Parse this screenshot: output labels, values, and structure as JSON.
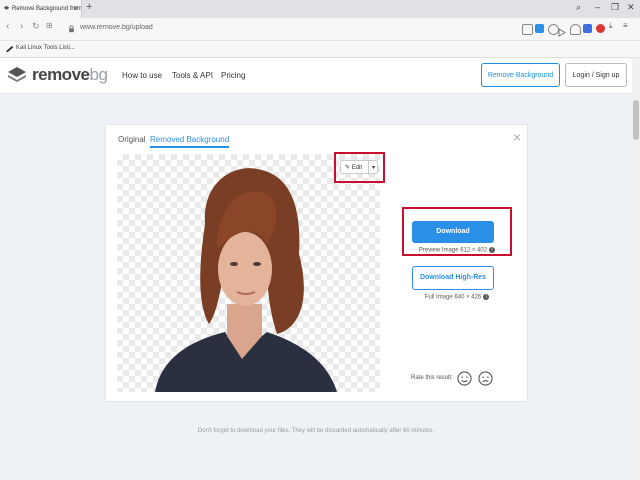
{
  "browser": {
    "tab_title": "Remove Background from",
    "tab_close": "×",
    "new_tab": "+",
    "url": "www.remove.bg/upload",
    "bookmark": "Kali Linux Tools Listi..."
  },
  "site": {
    "logo_main": "remove",
    "logo_suffix": "bg",
    "nav": [
      "How to use",
      "Tools & API",
      "Pricing"
    ],
    "header_buttons": {
      "remove_bg": "Remove Background",
      "login": "Login / Sign up"
    }
  },
  "card": {
    "tabs": {
      "original": "Original",
      "removed": "Removed Background"
    },
    "close": "×",
    "edit_label": "Edit",
    "edit_dropdown": "▾",
    "download": "Download",
    "preview_note": "Preview Image 612 × 402",
    "download_hires": "Download High-Res",
    "full_note": "Full Image 640 × 426",
    "info_glyph": "i",
    "rate_label": "Rate this result:"
  },
  "footer_note": "Don't forget to download your files. They will be discarded automatically after 60 minutes.",
  "colors": {
    "accent": "#2a8fe6",
    "highlight": "#c8102e"
  }
}
